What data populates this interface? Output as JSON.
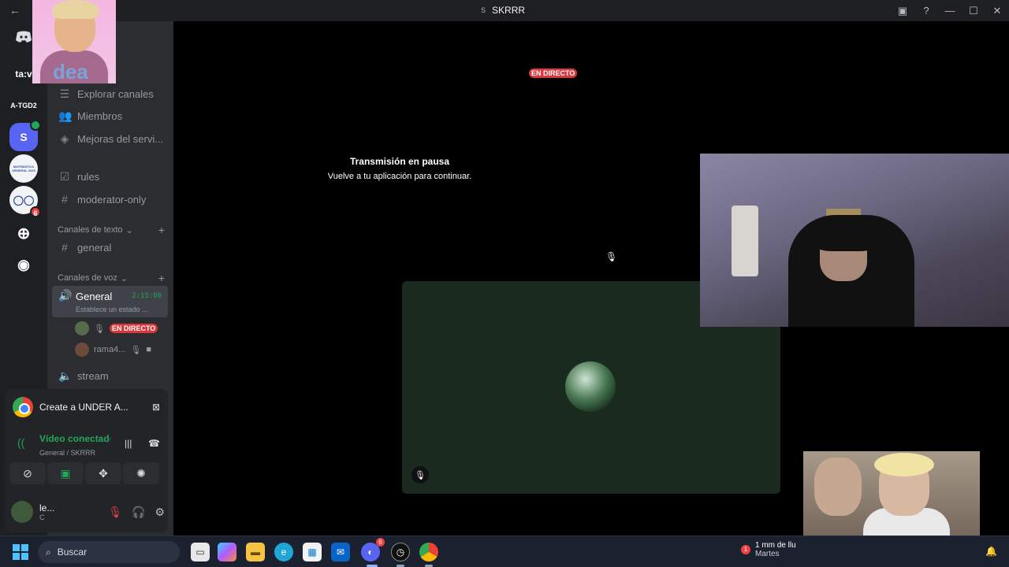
{
  "window": {
    "title": "SKRRR",
    "server_initial": "S",
    "back_icon": "arrow-left-icon",
    "controls": [
      "inbox-icon",
      "help-icon",
      "minimize-icon",
      "maximize-icon",
      "close-icon"
    ]
  },
  "guilds": [
    {
      "label": "ta:v",
      "badge": ""
    },
    {
      "label": "A-TGD2",
      "badge": ""
    },
    {
      "label": "S",
      "badge": ""
    },
    {
      "label": "MATEMATICA GENERAL 2025",
      "badge": ""
    },
    {
      "label": "",
      "badge": "6"
    }
  ],
  "channels": {
    "items": [
      {
        "label": "Explorar canales",
        "icon": "list-icon"
      },
      {
        "label": "Miembros",
        "icon": "members-icon"
      },
      {
        "label": "Mejoras del servi...",
        "icon": "boost-icon"
      },
      {
        "label": "rules",
        "icon": "rules-icon"
      },
      {
        "label": "moderator-only",
        "icon": "text-channel-icon"
      }
    ],
    "text_category": "Canales de texto",
    "text_channels": [
      {
        "label": "general"
      }
    ],
    "voice_category": "Canales de voz",
    "voice_active": {
      "name": "General",
      "timer": "2:15:00",
      "status": "Establece un estado ..."
    },
    "voice_users": [
      {
        "name": "",
        "live": "EN DIRECTO"
      },
      {
        "name": "rama4..."
      }
    ],
    "other_voice": [
      {
        "label": "stream"
      }
    ]
  },
  "panel": {
    "activity_title": "Create a UNDER A...",
    "voice_status": "Vídeo conectado",
    "voice_location": "General / SKRRR",
    "user_name": "le...",
    "user_status": "C"
  },
  "stage": {
    "live_badge": "EN DIRECTO",
    "paused_title": "Transmisión en pausa",
    "paused_sub": "Vuelve a tu aplicación para continuar."
  },
  "overlay": {
    "top_text": "dea"
  },
  "taskbar": {
    "search_placeholder": "Buscar",
    "discord_badge": "6",
    "weather_badge": "1",
    "weather_line1": "1 mm de llu",
    "weather_line2": "Martes"
  },
  "colors": {
    "accent_green": "#23a55a",
    "live_red": "#da373c",
    "bg_dark": "#1e1f22"
  }
}
